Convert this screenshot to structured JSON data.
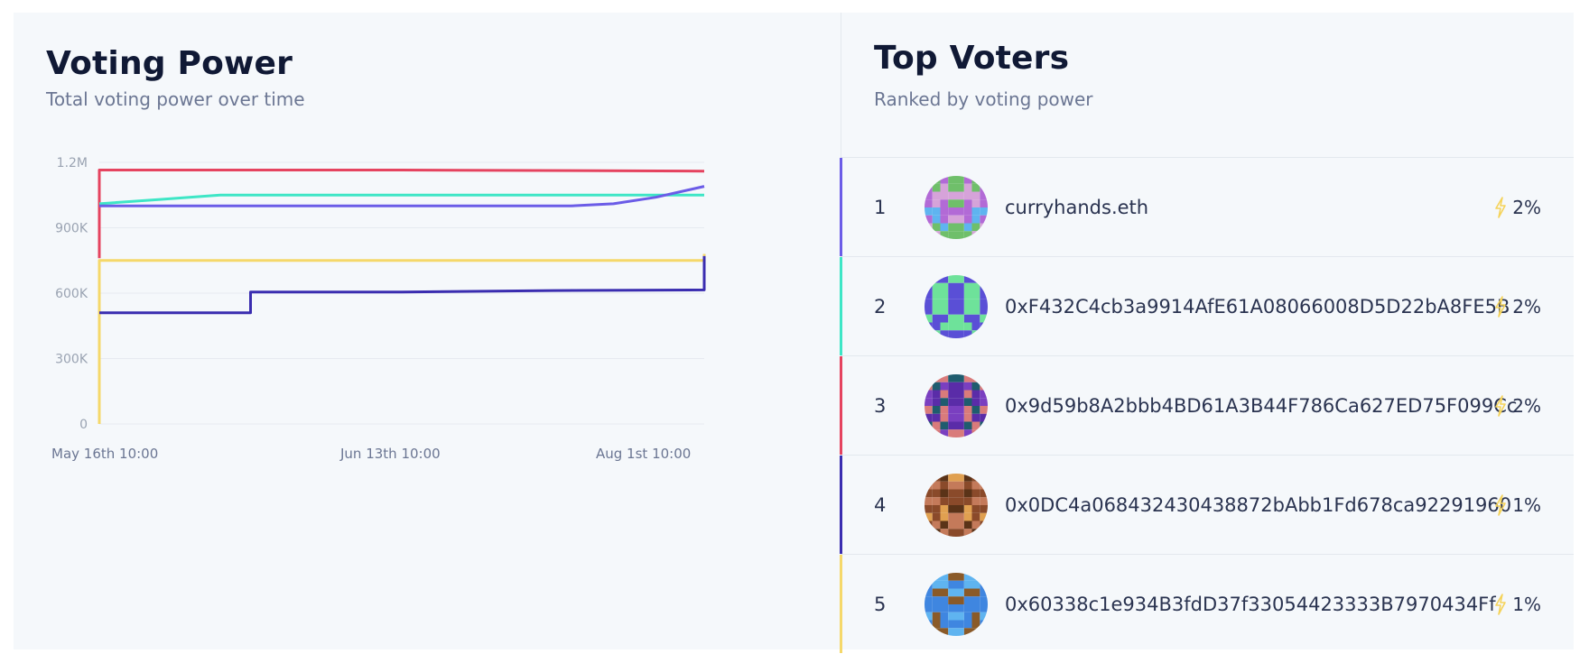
{
  "left": {
    "title": "Voting Power",
    "subtitle": "Total voting power over time"
  },
  "right": {
    "title": "Top Voters",
    "subtitle": "Ranked by voting power"
  },
  "voters": [
    {
      "rank": "1",
      "name": "curryhands.eth",
      "power": "2%",
      "color": "#6b5ce7"
    },
    {
      "rank": "2",
      "name": "0xF432C4cb3a9914AfE61A08066008D5D22bA8FE5B",
      "power": "2%",
      "color": "#3ee6c6"
    },
    {
      "rank": "3",
      "name": "0x9d59b8A2bbb4BD61A3B44F786Ca627ED75F099Cc",
      "power": "2%",
      "color": "#e5435f"
    },
    {
      "rank": "4",
      "name": "0x0DC4a068432430438872bAbb1Fd678ca92291960",
      "power": "1%",
      "color": "#3a2db0"
    },
    {
      "rank": "5",
      "name": "0x60338c1e934B3fdD37f33054423333B7970434Ff",
      "power": "1%",
      "color": "#f5d86a"
    }
  ],
  "chart_data": {
    "type": "line",
    "ylim": [
      0,
      1200000
    ],
    "y_ticks": [
      "0",
      "300K",
      "600K",
      "900K",
      "1.2M"
    ],
    "x_ticks": [
      "May 16th 10:00",
      "Jun 13th 10:00",
      "Aug 1st 10:00"
    ],
    "grid": true,
    "series": [
      {
        "color": "#e5435f",
        "x": [
          0,
          0,
          0.5,
          1
        ],
        "y": [
          760000,
          1165000,
          1165000,
          1160000
        ]
      },
      {
        "color": "#3ee6c6",
        "x": [
          0,
          0.1,
          0.2,
          0.5,
          1
        ],
        "y": [
          1010000,
          1030000,
          1050000,
          1050000,
          1050000
        ]
      },
      {
        "color": "#6b5ce7",
        "x": [
          0,
          0.3,
          0.78,
          0.85,
          0.92,
          1
        ],
        "y": [
          1000000,
          1000000,
          1000000,
          1010000,
          1040000,
          1090000
        ]
      },
      {
        "color": "#f5d86a",
        "x": [
          0,
          0,
          0.5,
          1,
          1
        ],
        "y": [
          0,
          750000,
          750000,
          750000,
          780000
        ]
      },
      {
        "color": "#3a2db0",
        "x": [
          0,
          0.25,
          0.25,
          0.5,
          0.75,
          1,
          1
        ],
        "y": [
          510000,
          510000,
          605000,
          605000,
          612000,
          615000,
          770000
        ]
      }
    ]
  }
}
